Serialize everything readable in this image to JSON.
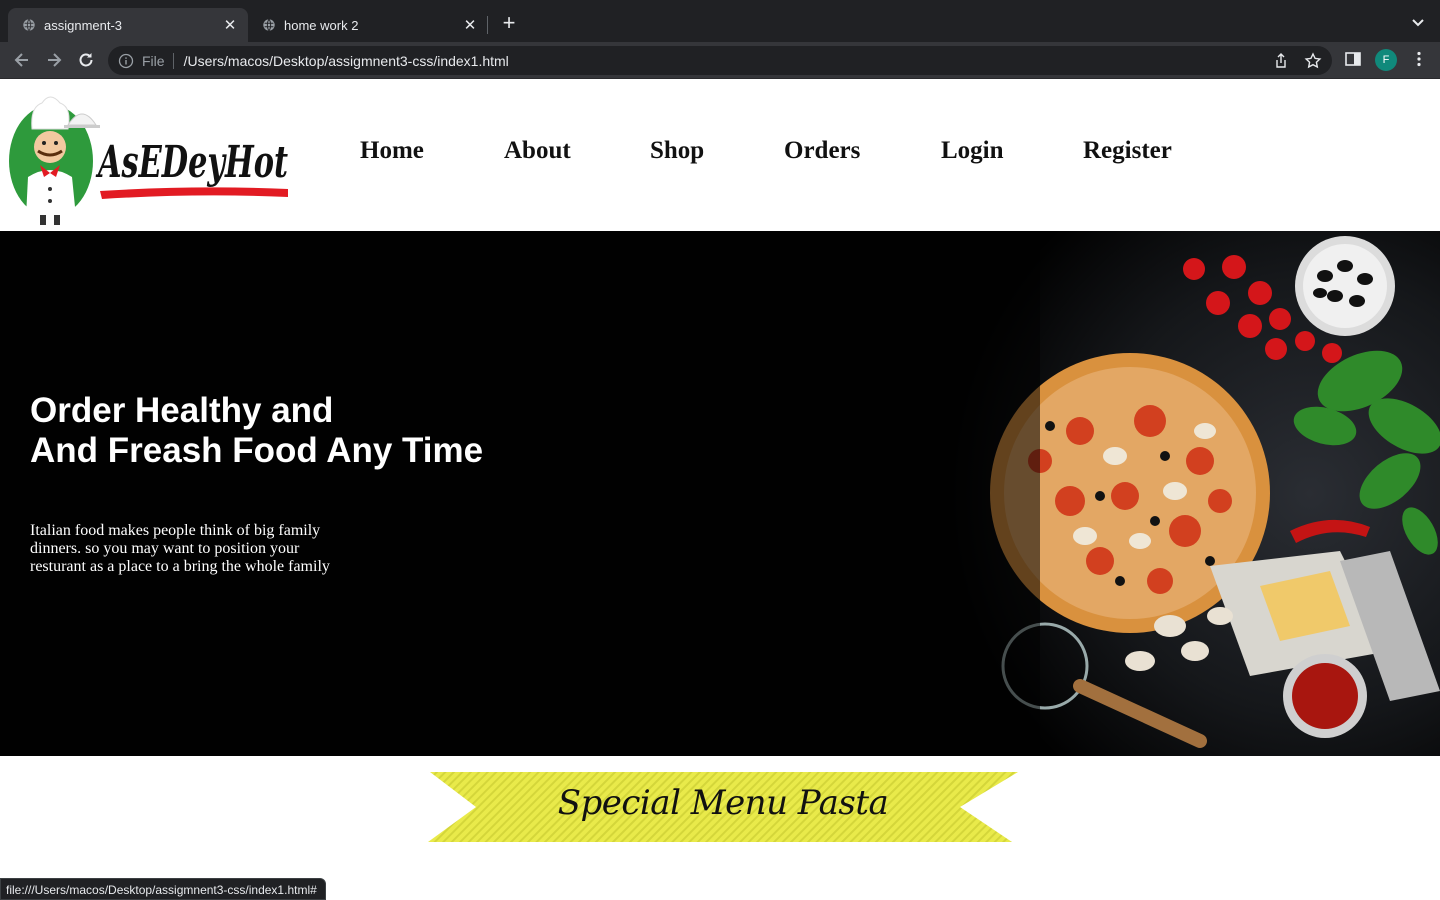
{
  "browser": {
    "tabs": [
      {
        "title": "assignment-3",
        "active": true
      },
      {
        "title": "home work 2",
        "active": false
      }
    ],
    "new_tab_label": "+",
    "omnibox": {
      "scheme_label": "File",
      "url": "/Users/macos/Desktop/assigmnent3-css/index1.html"
    },
    "profile_initial": "F",
    "status_url": "file:///Users/macos/Desktop/assigmnent3-css/index1.html#"
  },
  "site": {
    "logo_text": "AsEDeyHot",
    "nav": [
      "Home",
      "About",
      "Shop",
      "Orders",
      "Login",
      "Register"
    ],
    "hero": {
      "title_line1": "Order Healthy and",
      "title_line2": "And Freash Food Any Time",
      "paragraph": "Italian food makes people think of big family dinners. so you may want to position your resturant as a place to a bring the whole family"
    },
    "banner_text": "Special Menu Pasta"
  },
  "colors": {
    "chrome_dark": "#202124",
    "chrome_tab": "#35363a",
    "hero_bg": "#010101",
    "banner_yellow": "#e9ea4a",
    "logo_red": "#e21b23",
    "logo_green": "#2e9a3c",
    "avatar": "#10897b"
  },
  "icons": [
    "globe-icon",
    "close-icon",
    "back-arrow-icon",
    "forward-arrow-icon",
    "reload-icon",
    "info-icon",
    "share-icon",
    "star-icon",
    "sidebar-icon",
    "more-icon",
    "chevron-down-icon"
  ]
}
